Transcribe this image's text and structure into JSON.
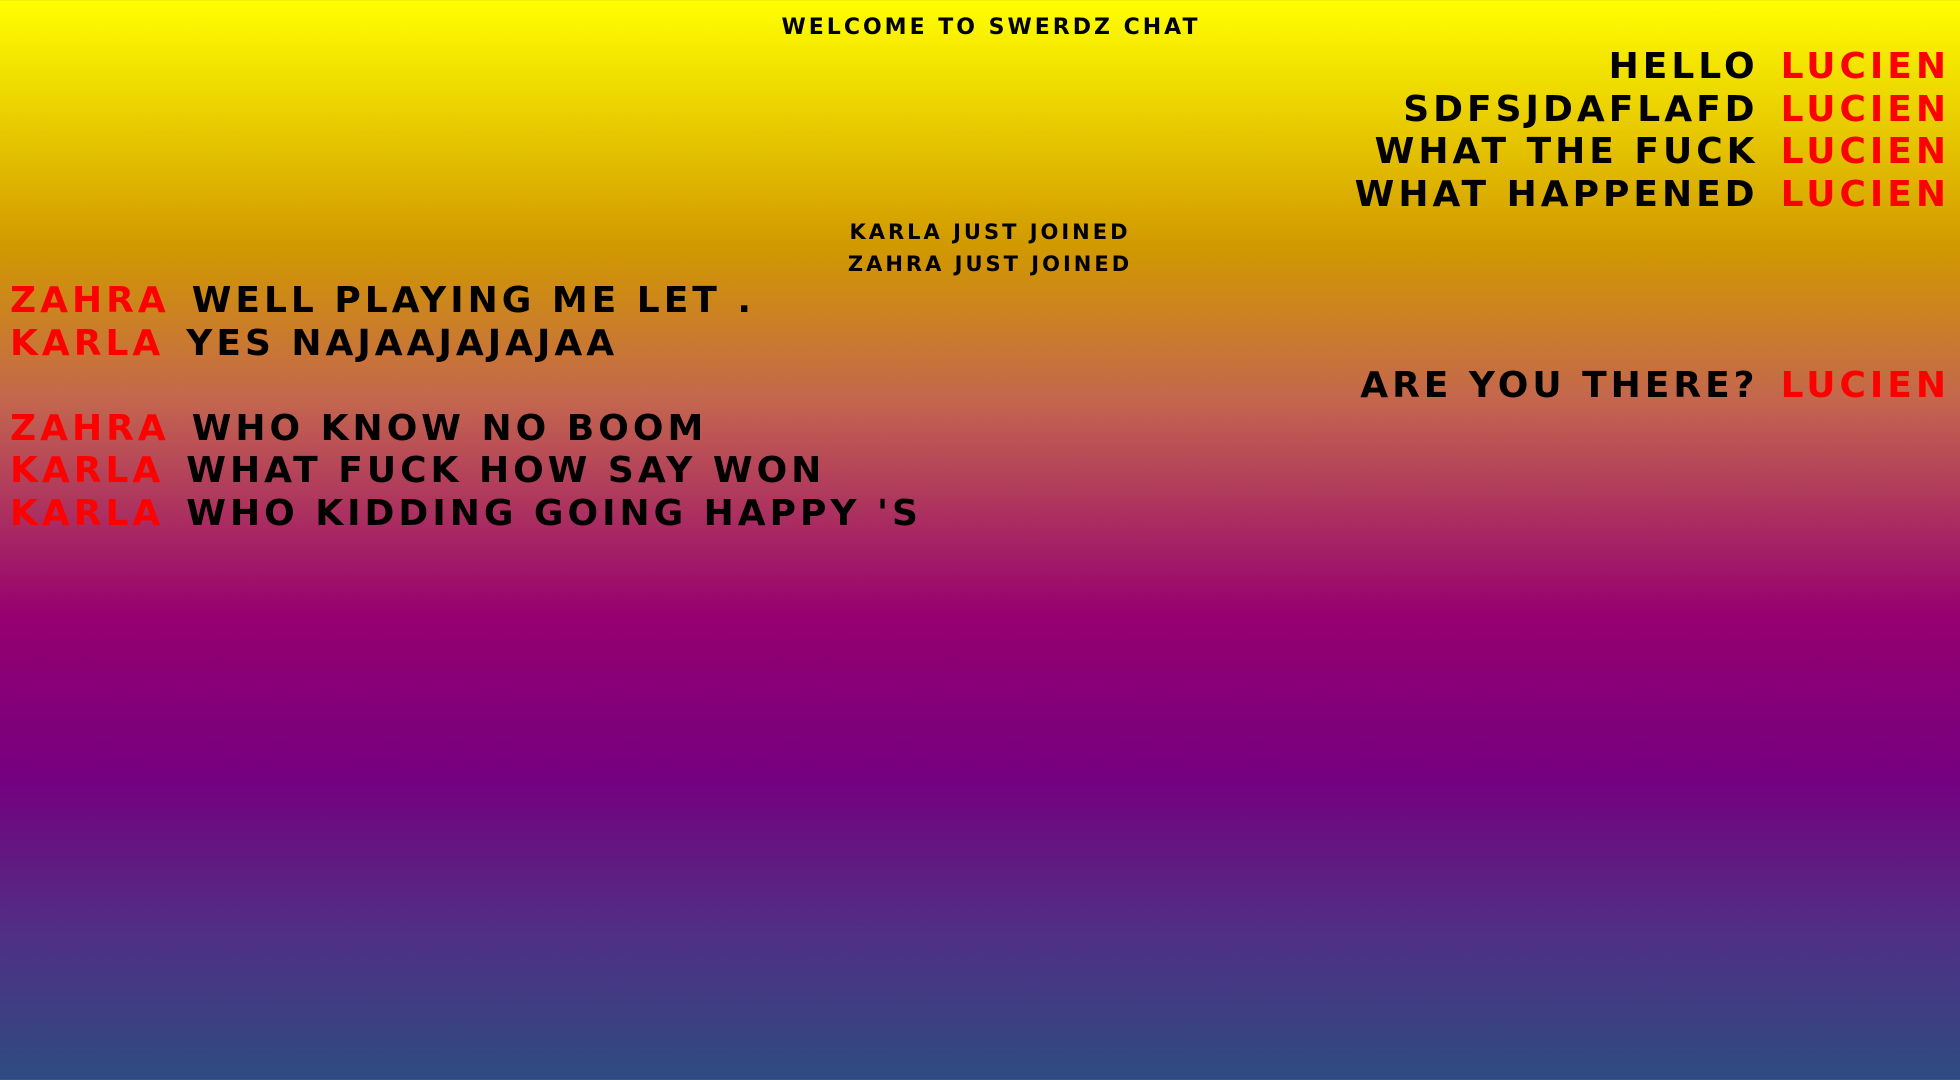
{
  "app": {
    "title": "WELCOME TO SWERDZ CHAT"
  },
  "colors": {
    "name": "#ff0000",
    "text": "#000000"
  },
  "messages": [
    {
      "kind": "outgoing",
      "text": "HELLO",
      "user": "LUCIEN"
    },
    {
      "kind": "outgoing",
      "text": "SDFSJDAFLAFD",
      "user": "LUCIEN"
    },
    {
      "kind": "outgoing",
      "text": "WHAT THE FUCK",
      "user": "LUCIEN"
    },
    {
      "kind": "outgoing",
      "text": "WHAT HAPPENED",
      "user": "LUCIEN"
    },
    {
      "kind": "system",
      "text": "KARLA JUST JOINED"
    },
    {
      "kind": "system",
      "text": "ZAHRA JUST JOINED"
    },
    {
      "kind": "incoming",
      "user": "ZAHRA",
      "text": "WELL PLAYING ME LET ."
    },
    {
      "kind": "incoming",
      "user": "KARLA",
      "text": "YES NAJAAJAJAJAA"
    },
    {
      "kind": "outgoing",
      "text": "ARE YOU THERE?",
      "user": "LUCIEN"
    },
    {
      "kind": "incoming",
      "user": "ZAHRA",
      "text": "WHO KNOW NO BOOM"
    },
    {
      "kind": "incoming",
      "user": "KARLA",
      "text": "WHAT FUCK HOW SAY WON"
    },
    {
      "kind": "incoming",
      "user": "KARLA",
      "text": "WHO KIDDING GOING HAPPY 'S"
    }
  ]
}
